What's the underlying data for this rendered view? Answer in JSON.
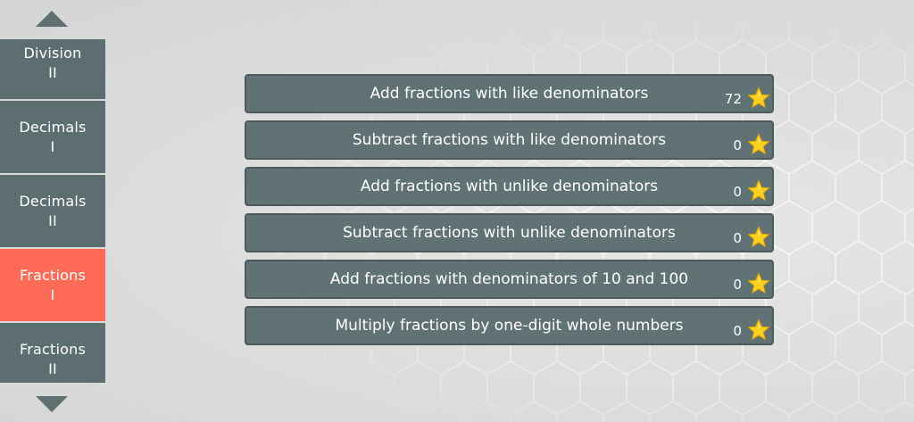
{
  "sidebar": {
    "scroll_up_icon": "triangle-up-icon",
    "scroll_down_icon": "triangle-down-icon",
    "categories": [
      {
        "line1": "Division",
        "line2": "II",
        "active": false
      },
      {
        "line1": "Decimals",
        "line2": "I",
        "active": false
      },
      {
        "line1": "Decimals",
        "line2": "II",
        "active": false
      },
      {
        "line1": "Fractions",
        "line2": "I",
        "active": true
      },
      {
        "line1": "Fractions",
        "line2": "II",
        "active": false
      }
    ]
  },
  "topics": [
    {
      "title": "Add fractions with like denominators",
      "score": "72",
      "icon": "star-icon"
    },
    {
      "title": "Subtract fractions with like denominators",
      "score": "0",
      "icon": "star-icon"
    },
    {
      "title": "Add fractions with unlike denominators",
      "score": "0",
      "icon": "star-icon"
    },
    {
      "title": "Subtract fractions with unlike denominators",
      "score": "0",
      "icon": "star-icon"
    },
    {
      "title": "Add fractions with denominators of 10 and 100",
      "score": "0",
      "icon": "star-icon"
    },
    {
      "title": "Multiply fractions by one-digit whole numbers",
      "score": "0",
      "icon": "star-icon"
    }
  ],
  "colors": {
    "background": "#dcdddd",
    "panel": "#5d6e70",
    "active_category": "#ff6b57",
    "star": "#ffd21f",
    "text": "#ffffff"
  }
}
